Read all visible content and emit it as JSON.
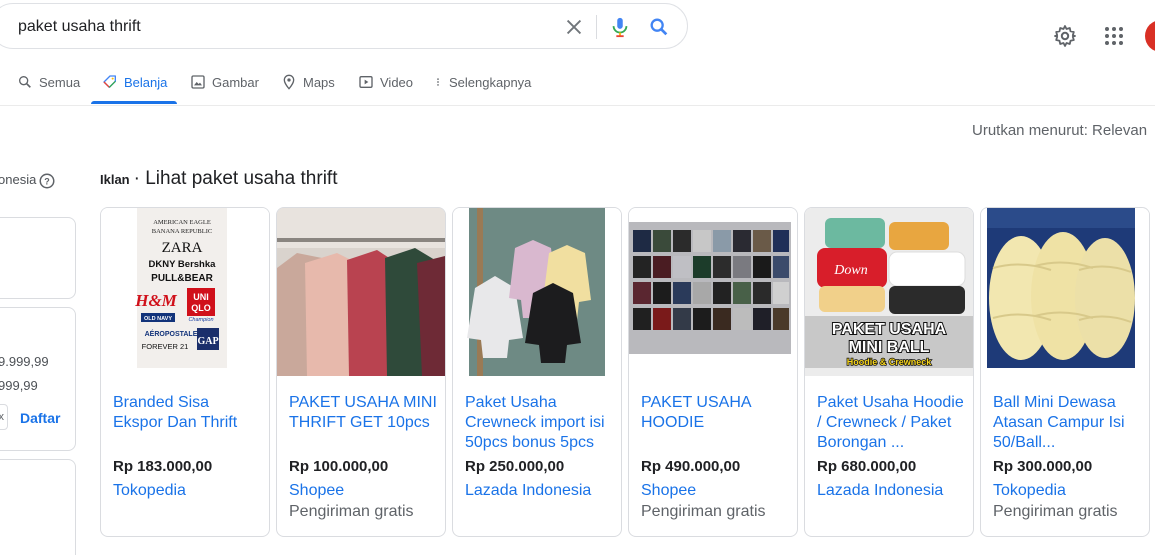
{
  "search": {
    "query": "paket usaha thrift"
  },
  "tabs": [
    {
      "label": "Semua",
      "icon": "search-icon"
    },
    {
      "label": "Belanja",
      "icon": "shopping-tag-icon"
    },
    {
      "label": "Gambar",
      "icon": "image-icon"
    },
    {
      "label": "Maps",
      "icon": "map-pin-icon"
    },
    {
      "label": "Video",
      "icon": "video-icon"
    },
    {
      "label": "Selengkapnya",
      "icon": "more-vert-icon"
    }
  ],
  "sort": {
    "label": "Urutkan menurut: Relevan"
  },
  "sidebar": {
    "location": "onesia",
    "price_min": "9.999,99",
    "price_max": "999,99",
    "clear_char": "x",
    "apply": "Daftar"
  },
  "ads": {
    "label": "Iklan",
    "title": "· Lihat paket usaha thrift"
  },
  "image_brands": [
    "AMERICAN EAGLE",
    "BANANA REPUBLIC",
    "ZARA",
    "DKNY Bershka",
    "PULL&BEAR",
    "H&M",
    "UNI",
    "QLO",
    "OLD NAVY",
    "Champion",
    "AÉROPOSTALE",
    "FOREVER 21",
    "GAP"
  ],
  "image_overlay": {
    "line1": "PAKET USAHA",
    "line2": "MINI BALL",
    "line3": "Hoodie & Crewneck",
    "sweater_text": "Down"
  },
  "products": [
    {
      "title": "Branded Sisa Ekspor Dan Thrift",
      "price": "Rp 183.000,00",
      "seller": "Tokopedia",
      "shipping": ""
    },
    {
      "title": "PAKET USAHA MINI THRIFT GET 10pcs",
      "price": "Rp 100.000,00",
      "seller": "Shopee",
      "shipping": "Pengiriman gratis"
    },
    {
      "title": "Paket Usaha Crewneck import isi 50pcs bonus 5pcs",
      "price": "Rp 250.000,00",
      "seller": "Lazada Indonesia",
      "shipping": ""
    },
    {
      "title": "PAKET USAHA HOODIE",
      "price": "Rp 490.000,00",
      "seller": "Shopee",
      "shipping": "Pengiriman gratis"
    },
    {
      "title": "Paket Usaha Hoodie / Crewneck / Paket Borongan ...",
      "price": "Rp 680.000,00",
      "seller": "Lazada Indonesia",
      "shipping": ""
    },
    {
      "title": "Ball Mini Dewasa Atasan Campur Isi 50/Ball...",
      "price": "Rp 300.000,00",
      "seller": "Tokopedia",
      "shipping": "Pengiriman gratis"
    }
  ],
  "colors": {
    "accent": "#1a73e8",
    "avatar": "#d93025"
  }
}
